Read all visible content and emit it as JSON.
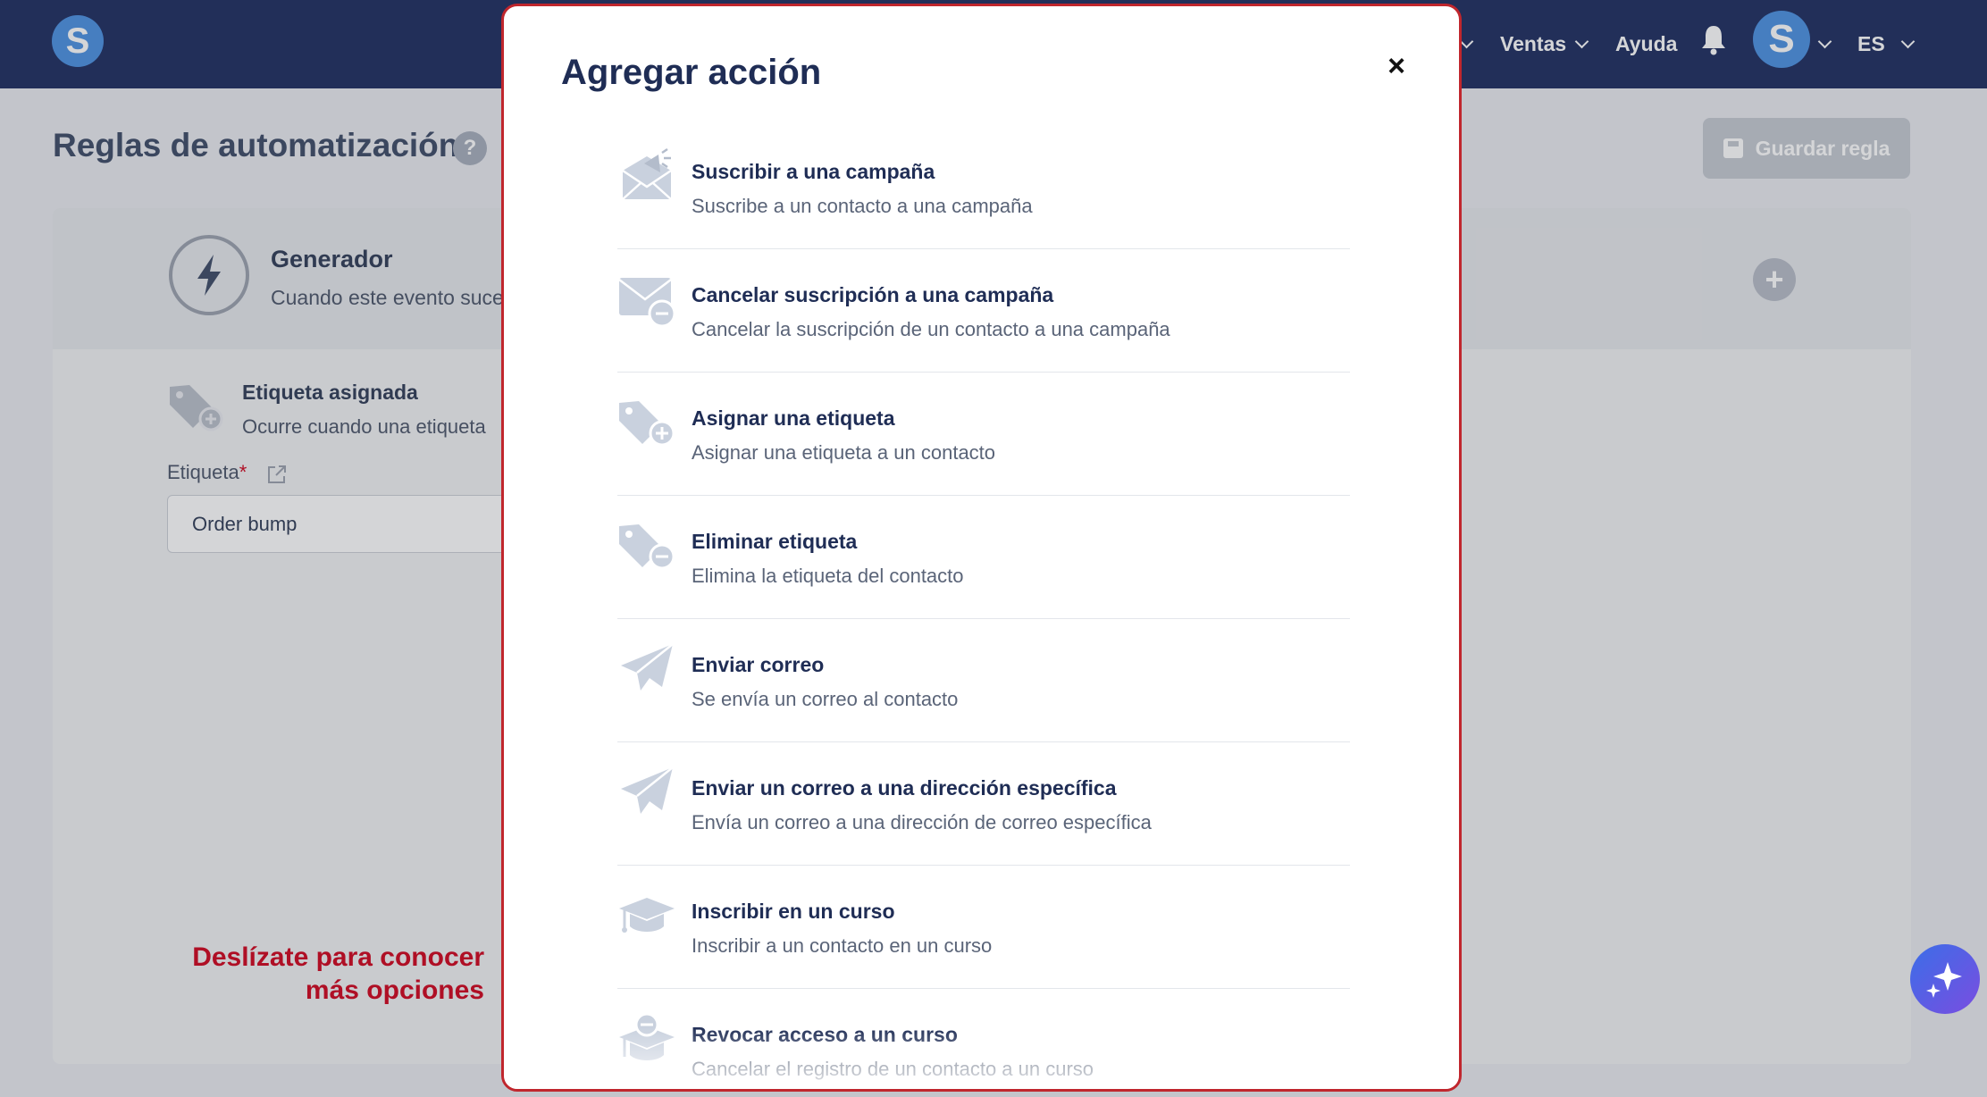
{
  "nav": {
    "logo_letter": "S",
    "items": [
      {
        "label": "Ventas"
      },
      {
        "label": "Ayuda"
      }
    ],
    "avatar_letter": "S",
    "language": "ES"
  },
  "page": {
    "title": "Reglas de automatización",
    "help": "?",
    "save_button": "Guardar regla"
  },
  "trigger": {
    "title": "Generador",
    "subtitle": "Cuando este evento suce",
    "tag_title": "Etiqueta asignada",
    "tag_subtitle": "Ocurre cuando una etiqueta",
    "field_label": "Etiqueta",
    "required_mark": "*",
    "field_value": "Order bump"
  },
  "scroll_hint": {
    "line1": "Deslízate para conocer",
    "line2": "más opciones"
  },
  "modal": {
    "title": "Agregar acción",
    "close": "×",
    "actions": [
      {
        "icon": "campaign-subscribe-icon",
        "title": "Suscribir a una campaña",
        "description": "Suscribe a un contacto a una campaña"
      },
      {
        "icon": "campaign-unsubscribe-icon",
        "title": "Cancelar suscripción a una campaña",
        "description": "Cancelar la suscripción de un contacto a una campaña"
      },
      {
        "icon": "tag-add-icon",
        "title": "Asignar una etiqueta",
        "description": "Asignar una etiqueta a un contacto"
      },
      {
        "icon": "tag-remove-icon",
        "title": "Eliminar etiqueta",
        "description": "Elimina la etiqueta del contacto"
      },
      {
        "icon": "paper-plane-icon",
        "title": "Enviar correo",
        "description": "Se envía un correo al contacto"
      },
      {
        "icon": "paper-plane-icon",
        "title": "Enviar un correo a una dirección específica",
        "description": "Envía un correo a una dirección de correo específica"
      },
      {
        "icon": "graduation-cap-icon",
        "title": "Inscribir en un curso",
        "description": "Inscribir a un contacto en un curso"
      },
      {
        "icon": "graduation-cap-remove-icon",
        "title": "Revocar acceso a un curso",
        "description": "Cancelar el registro de un contacto a un curso"
      }
    ]
  },
  "colors": {
    "nav_bg": "#1b2b5e",
    "accent": "#4a90e2",
    "modal_border": "#c0262d",
    "hint_red": "#d0021b",
    "icon_gray": "#c9d1de"
  }
}
